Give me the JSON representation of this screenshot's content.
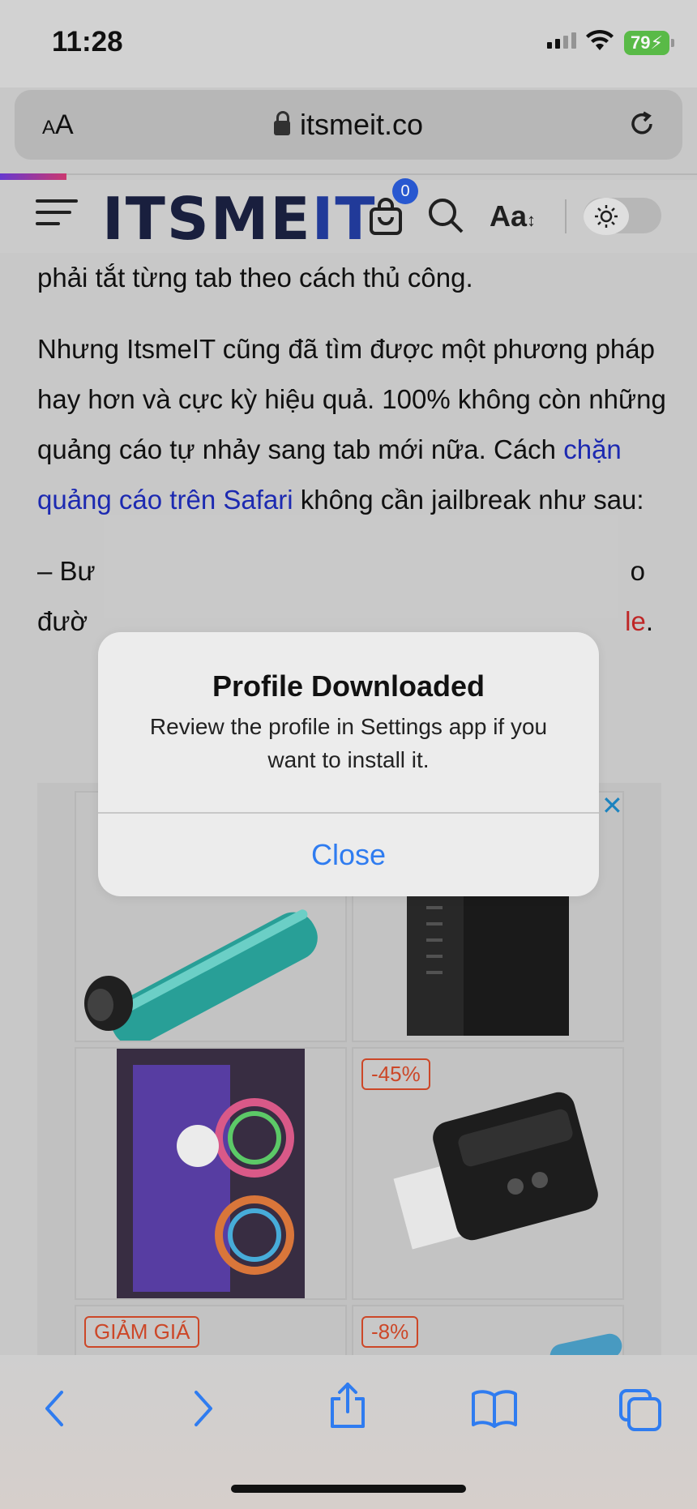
{
  "status_bar": {
    "time": "11:28",
    "battery": "79"
  },
  "url_bar": {
    "text_size_label": "AA",
    "domain": "itsmeit.co"
  },
  "site_header": {
    "logo_main": "ITSME",
    "logo_accent": "IT",
    "cart_count": "0",
    "font_label": "Aa"
  },
  "article": {
    "para1": "phải tắt từng tab theo cách thủ công.",
    "para2_pre": "Nhưng ItsmeIT cũng đã tìm được một phương pháp hay hơn và cực kỳ hiệu quả. 100% không còn những quảng cáo tự nhảy sang tab mới nữa. Cách ",
    "para2_link": "chặn quảng cáo trên Safari",
    "para2_post": " không cần jailbreak như sau:",
    "para3_start": "– Bư",
    "para3_end": "o",
    "para3_line2_start": "đườ",
    "para3_link_end": "le",
    "para3_period": "."
  },
  "ad_grid": {
    "tags": [
      "-45%",
      "GIẢM GIÁ",
      "-8%"
    ],
    "close_icon": "close-icon"
  },
  "alert": {
    "title": "Profile Downloaded",
    "message": "Review the profile in Settings app if you want to install it.",
    "button": "Close"
  },
  "colors": {
    "accent": "#2f7cf0",
    "link": "#1d2bb7",
    "tag_red": "#d34a2a"
  }
}
